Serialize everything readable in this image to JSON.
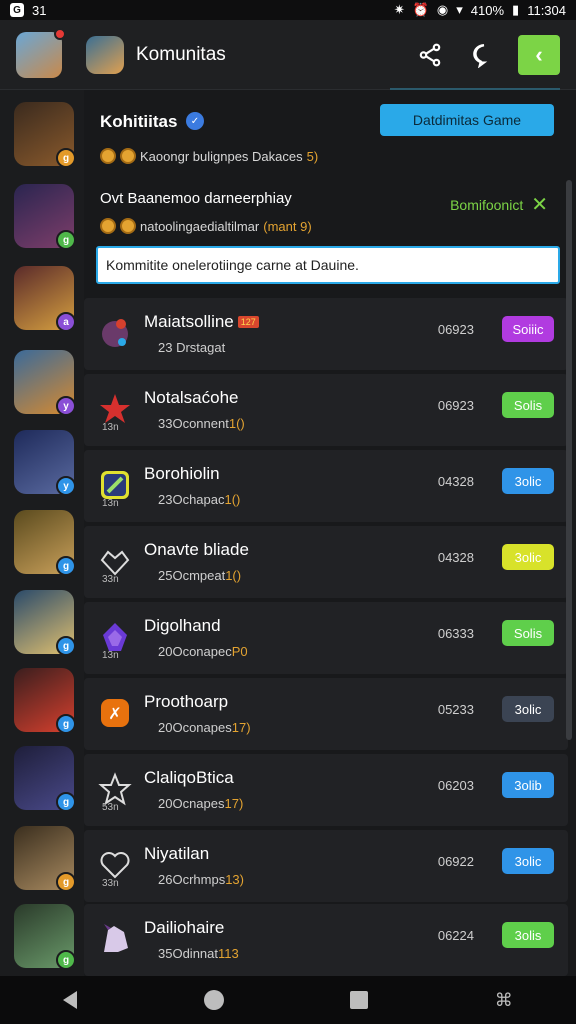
{
  "status_bar": {
    "left_text": "31",
    "battery": "410%",
    "time": "11:304"
  },
  "app_bar": {
    "title": "Komunitas"
  },
  "header_card": {
    "title": "Kohitiitas",
    "button_label": "Datdimitas Game",
    "subtitle": "Kaoongr bulignpes Dakaces",
    "subtitle_highlight": "5)"
  },
  "promo": {
    "title": "Ovt Baanemoo darneerphiay",
    "action_label": "Bomifoonict",
    "subtitle": "natoolingaedialtilmar",
    "subtitle_highlight": "(mant 9)"
  },
  "search": {
    "value": "Kommitite onelerotiinge carne at Dauine."
  },
  "rows": [
    {
      "title": "Maiatsolline",
      "tag": "127",
      "small": "",
      "sub": "23 Drstagat",
      "sub_highlight": "",
      "num": "06923",
      "btn": "Soiiic",
      "btn_color": "#b13be0"
    },
    {
      "title": "Notalsaćohe",
      "tag": "",
      "small": "13n",
      "sub": "33Oconnent",
      "sub_highlight": "1()",
      "num": "06923",
      "btn": "Solis",
      "btn_color": "#5fcf4b"
    },
    {
      "title": "Borohiolin",
      "tag": "",
      "small": "13n",
      "sub": "23Ochapac",
      "sub_highlight": "1()",
      "num": "04328",
      "btn": "3olic",
      "btn_color": "#2f94e8"
    },
    {
      "title": "Onavte bliade",
      "tag": "",
      "small": "33n",
      "sub": "25Ocmpeat",
      "sub_highlight": "1()",
      "num": "04328",
      "btn": "3olic",
      "btn_color": "#d8e22a"
    },
    {
      "title": "Digolhand",
      "tag": "",
      "small": "13n",
      "sub": "20Oconapec",
      "sub_highlight": "P0",
      "num": "06333",
      "btn": "Solis",
      "btn_color": "#5fcf4b"
    },
    {
      "title": "Proothoarp",
      "tag": "",
      "small": "",
      "sub": "20Oconapes",
      "sub_highlight": "17)",
      "num": "05233",
      "btn": "3olic",
      "btn_color": "#3b4453"
    },
    {
      "title": "ClaliqoBtica",
      "tag": "",
      "small": "53n",
      "sub": "20Ocnapes",
      "sub_highlight": "17)",
      "num": "06203",
      "btn": "3olib",
      "btn_color": "#2f94e8"
    },
    {
      "title": "Niyatilan",
      "tag": "",
      "small": "33n",
      "sub": "26Ocrhmps",
      "sub_highlight": "13)",
      "num": "06922",
      "btn": "3olic",
      "btn_color": "#2f94e8"
    },
    {
      "title": "Dailiohaire",
      "tag": "",
      "small": "",
      "sub": "35Odinnat",
      "sub_highlight": "113",
      "num": "06224",
      "btn": "3olis",
      "btn_color": "#5fcf4b"
    }
  ]
}
